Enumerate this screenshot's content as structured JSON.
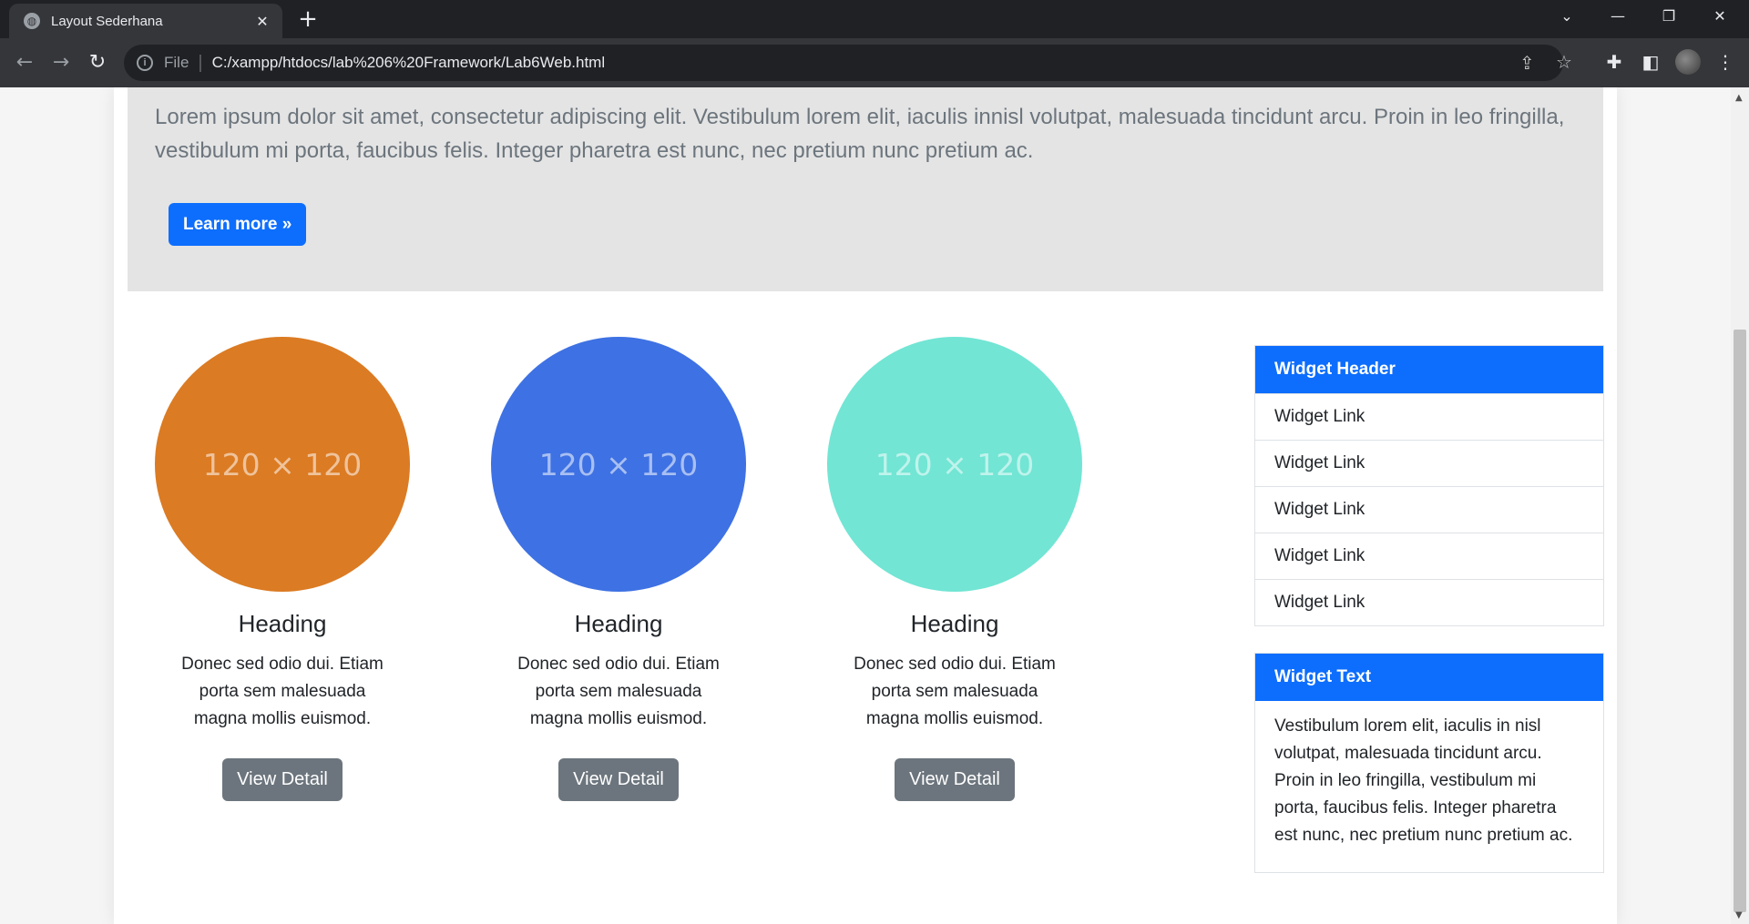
{
  "browser": {
    "tab_title": "Layout Sederhana",
    "tab_close": "✕",
    "new_tab": "+",
    "file_label": "File",
    "url": "C:/xampp/htdocs/lab%206%20Framework/Lab6Web.html",
    "win_controls": [
      "⌄",
      "—",
      "❐",
      "✕"
    ]
  },
  "jumbotron": {
    "text": "Lorem ipsum dolor sit amet, consectetur adipiscing elit. Vestibulum lorem elit, iaculis innisl volutpat, malesuada tincidunt arcu. Proin in leo fringilla, vestibulum mi porta, faucibus felis. Integer pharetra est nunc, nec pretium nunc pretium ac.",
    "button": "Learn more »"
  },
  "features": [
    {
      "placeholder": "120 × 120",
      "color": "#db7b23",
      "heading": "Heading",
      "text": "Donec sed odio dui. Etiam porta sem malesuada magna mollis euismod.",
      "button": "View Detail"
    },
    {
      "placeholder": "120 × 120",
      "color": "#3e71e3",
      "heading": "Heading",
      "text": "Donec sed odio dui. Etiam porta sem malesuada magna mollis euismod.",
      "button": "View Detail"
    },
    {
      "placeholder": "120 × 120",
      "color": "#72e5d4",
      "heading": "Heading",
      "text": "Donec sed odio dui. Etiam porta sem malesuada magna mollis euismod.",
      "button": "View Detail"
    }
  ],
  "widget_links": {
    "header": "Widget Header",
    "links": [
      "Widget Link",
      "Widget Link",
      "Widget Link",
      "Widget Link",
      "Widget Link"
    ]
  },
  "widget_text": {
    "header": "Widget Text",
    "text": "Vestibulum lorem elit, iaculis in nisl volutpat, malesuada tincidunt arcu. Proin in leo fringilla, vestibulum mi porta, faucibus felis. Integer pharetra est nunc, nec pretium nunc pretium ac."
  },
  "colors": {
    "primary": "#0d6efd",
    "secondary": "#6c757d",
    "jumbotron_bg": "#e4e4e4"
  }
}
